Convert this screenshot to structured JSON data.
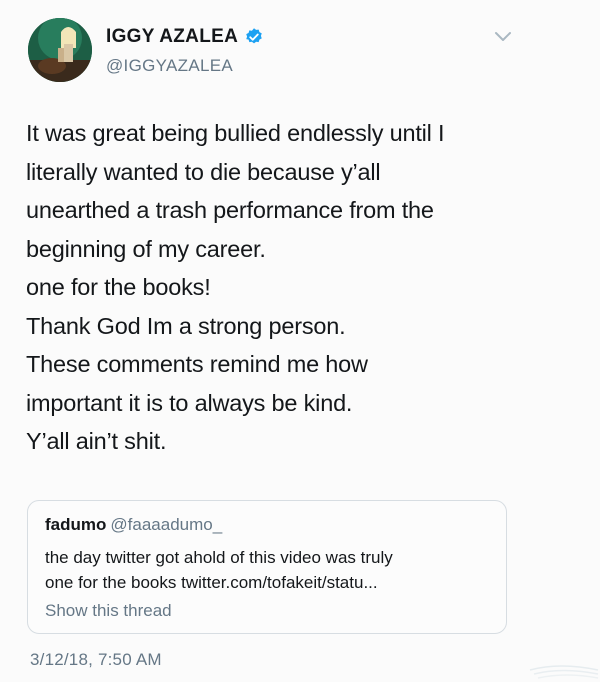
{
  "user": {
    "display_name": "IGGY AZALEA",
    "handle": "@IGGYAZALEA",
    "verified_icon": "verified-badge-icon",
    "menu_icon": "chevron-down-icon"
  },
  "tweet": {
    "lines": [
      "It was great being bullied endlessly until I",
      "literally wanted to die because y’all",
      "unearthed a trash performance from the",
      "beginning of my career.",
      "one for the books!",
      "Thank God Im a strong person.",
      "These comments remind me how",
      "important it is to always be kind.",
      "Y’all ain’t shit."
    ],
    "timestamp": "3/12/18, 7:50 AM"
  },
  "quote": {
    "name": "fadumo",
    "handle": "@faaaadumo_",
    "text_lines": [
      "the day twitter got ahold of this video was truly",
      "one for the books twitter.com/tofakeit/statu..."
    ],
    "show_thread": "Show this thread"
  },
  "colors": {
    "text": "#14171a",
    "secondary": "#657786",
    "verified": "#1da1f2",
    "border": "#d7dde2"
  }
}
